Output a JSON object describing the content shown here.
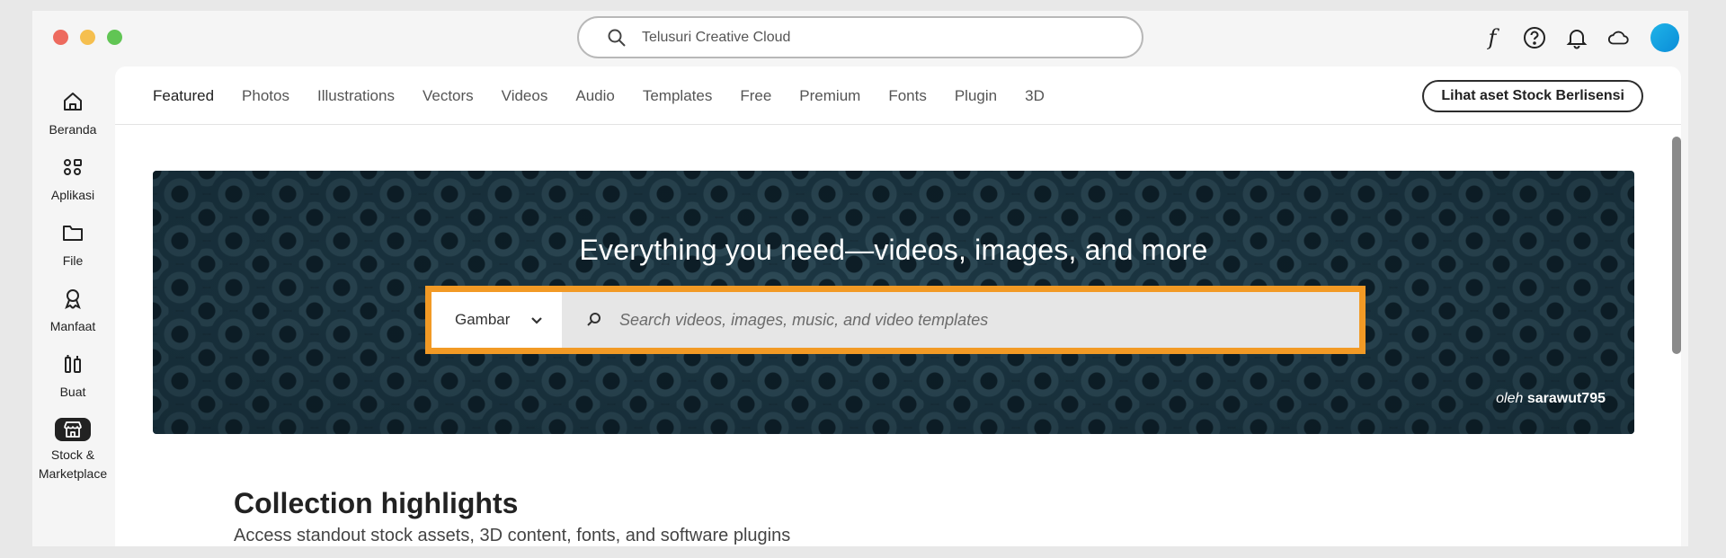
{
  "titlebar": {
    "search_placeholder": "Telusuri Creative Cloud",
    "icons": [
      "fonts-icon",
      "help-icon",
      "notifications-icon",
      "cloud-icon",
      "avatar"
    ]
  },
  "sidebar": {
    "items": [
      {
        "label": "Beranda",
        "icon": "home-icon"
      },
      {
        "label": "Aplikasi",
        "icon": "apps-icon"
      },
      {
        "label": "File",
        "icon": "folder-icon"
      },
      {
        "label": "Manfaat",
        "icon": "award-icon"
      },
      {
        "label": "Buat",
        "icon": "create-icon"
      },
      {
        "label": "Stock &\nMarketplace",
        "icon": "store-icon",
        "active": true
      }
    ]
  },
  "tabs": [
    {
      "label": "Featured",
      "active": true
    },
    {
      "label": "Photos"
    },
    {
      "label": "Illustrations"
    },
    {
      "label": "Vectors"
    },
    {
      "label": "Videos"
    },
    {
      "label": "Audio"
    },
    {
      "label": "Templates"
    },
    {
      "label": "Free"
    },
    {
      "label": "Premium"
    },
    {
      "label": "Fonts"
    },
    {
      "label": "Plugin"
    },
    {
      "label": "3D"
    }
  ],
  "licensed_button": "Lihat aset Stock Berlisensi",
  "hero": {
    "title": "Everything you need—videos, images, and more",
    "select_value": "Gambar",
    "search_placeholder": "Search videos, images, music, and video templates",
    "credit_by": "oleh",
    "credit_author": "sarawut795",
    "highlight_color": "#f29a25"
  },
  "collection": {
    "title": "Collection highlights",
    "subtitle": "Access standout stock assets, 3D content, fonts, and software plugins"
  }
}
